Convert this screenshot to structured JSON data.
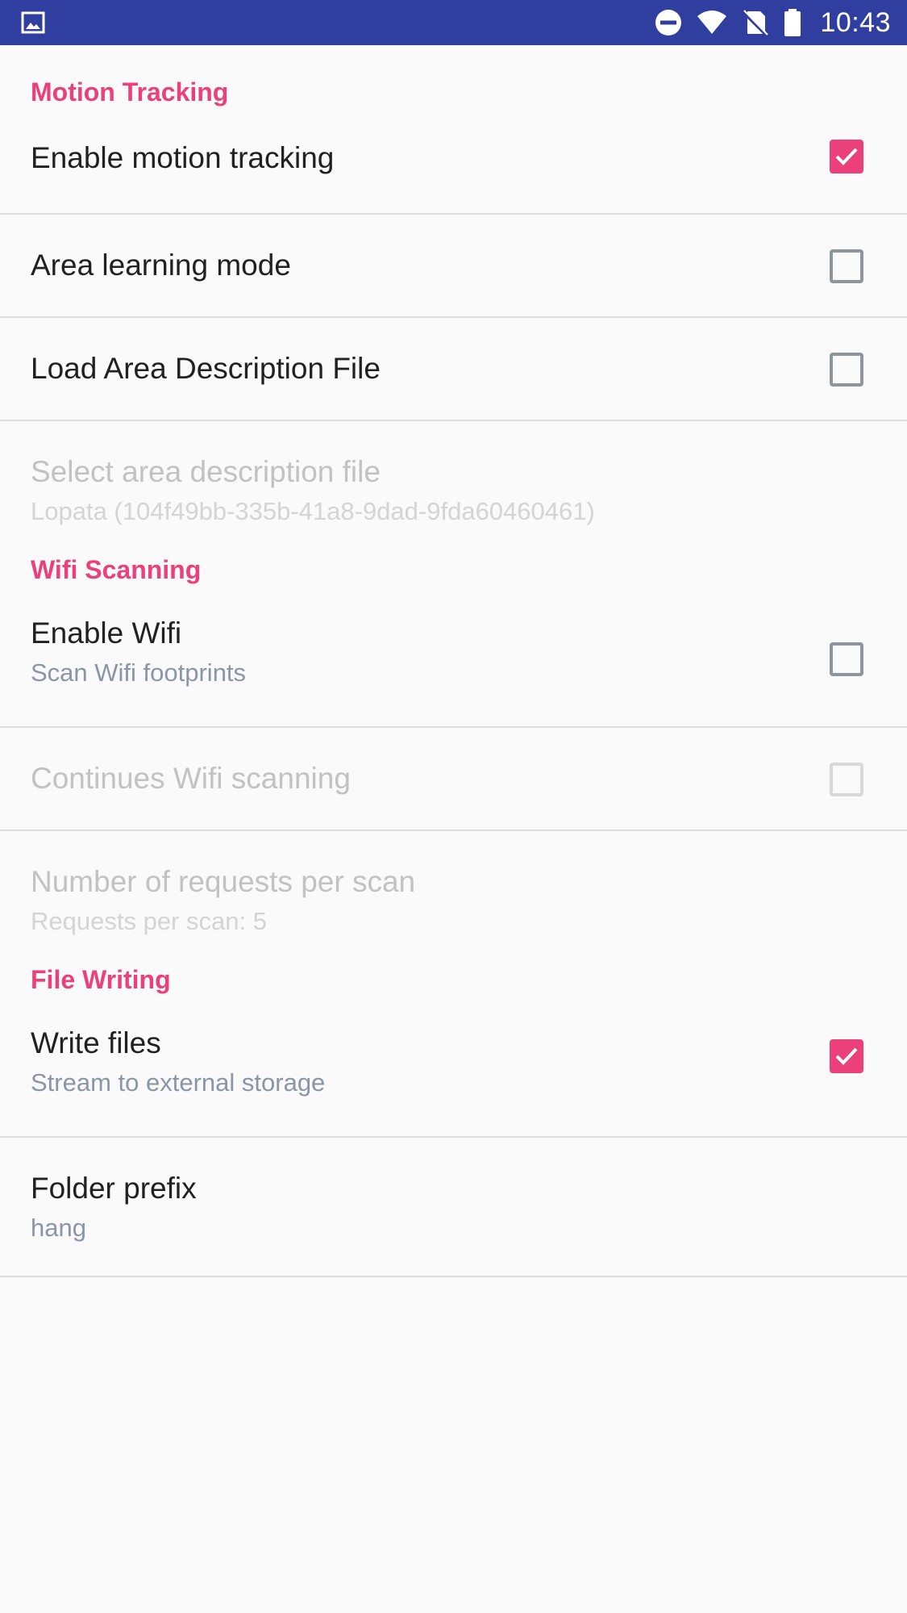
{
  "status_bar": {
    "time": "10:43",
    "icons": [
      "image-icon",
      "do-not-disturb-icon",
      "wifi-icon",
      "no-sim-icon",
      "battery-icon"
    ],
    "background": "#303f9f"
  },
  "colors": {
    "accent": "#ec407a",
    "divider": "#dedede"
  },
  "sections": {
    "motion": {
      "header": "Motion Tracking",
      "items": [
        {
          "title": "Enable motion tracking",
          "checked": true
        },
        {
          "title": "Area learning mode",
          "checked": false
        },
        {
          "title": "Load Area Description File",
          "checked": false
        },
        {
          "title": "Select area description file",
          "summary": "Lopata (104f49bb-335b-41a8-9dad-9fda60460461)",
          "enabled": false
        }
      ]
    },
    "wifi": {
      "header": "Wifi Scanning",
      "items": [
        {
          "title": "Enable Wifi",
          "summary": "Scan Wifi footprints",
          "checked": false
        },
        {
          "title": "Continues Wifi scanning",
          "checked": false,
          "enabled": false
        },
        {
          "title": "Number of requests per scan",
          "summary": "Requests per scan: 5",
          "enabled": false
        }
      ]
    },
    "file": {
      "header": "File Writing",
      "items": [
        {
          "title": "Write files",
          "summary": "Stream to external storage",
          "checked": true
        },
        {
          "title": "Folder prefix",
          "summary": "hang"
        }
      ]
    }
  }
}
